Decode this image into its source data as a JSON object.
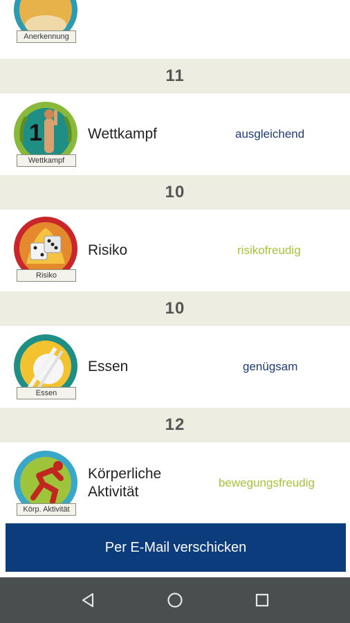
{
  "top_partial": {
    "badge_label": "Anerkennung"
  },
  "sections": [
    {
      "score": "11",
      "category": "Wettkampf",
      "badge_label": "Wettkampf",
      "rating": "ausgleichend",
      "rating_color": "#1f3b73"
    },
    {
      "score": "10",
      "category": "Risiko",
      "badge_label": "Risiko",
      "rating": "risikofreudig",
      "rating_color": "#a7c23a"
    },
    {
      "score": "10",
      "category": "Essen",
      "badge_label": "Essen",
      "rating": "genügsam",
      "rating_color": "#1f3b73"
    },
    {
      "score": "12",
      "category_line1": "Körperliche",
      "category_line2": "Aktivität",
      "badge_label": "Körp. Aktivität",
      "rating": "bewegungsfreudig",
      "rating_color": "#a7c23a"
    }
  ],
  "email_button": {
    "label": "Per E-Mail verschicken",
    "color": "#0d3c7c"
  },
  "navbar": {
    "back": "back-icon",
    "home": "home-icon",
    "recents": "recents-icon"
  },
  "colors": {
    "header_bg": "#eeede2",
    "navbar_bg": "#4a4e4e"
  }
}
